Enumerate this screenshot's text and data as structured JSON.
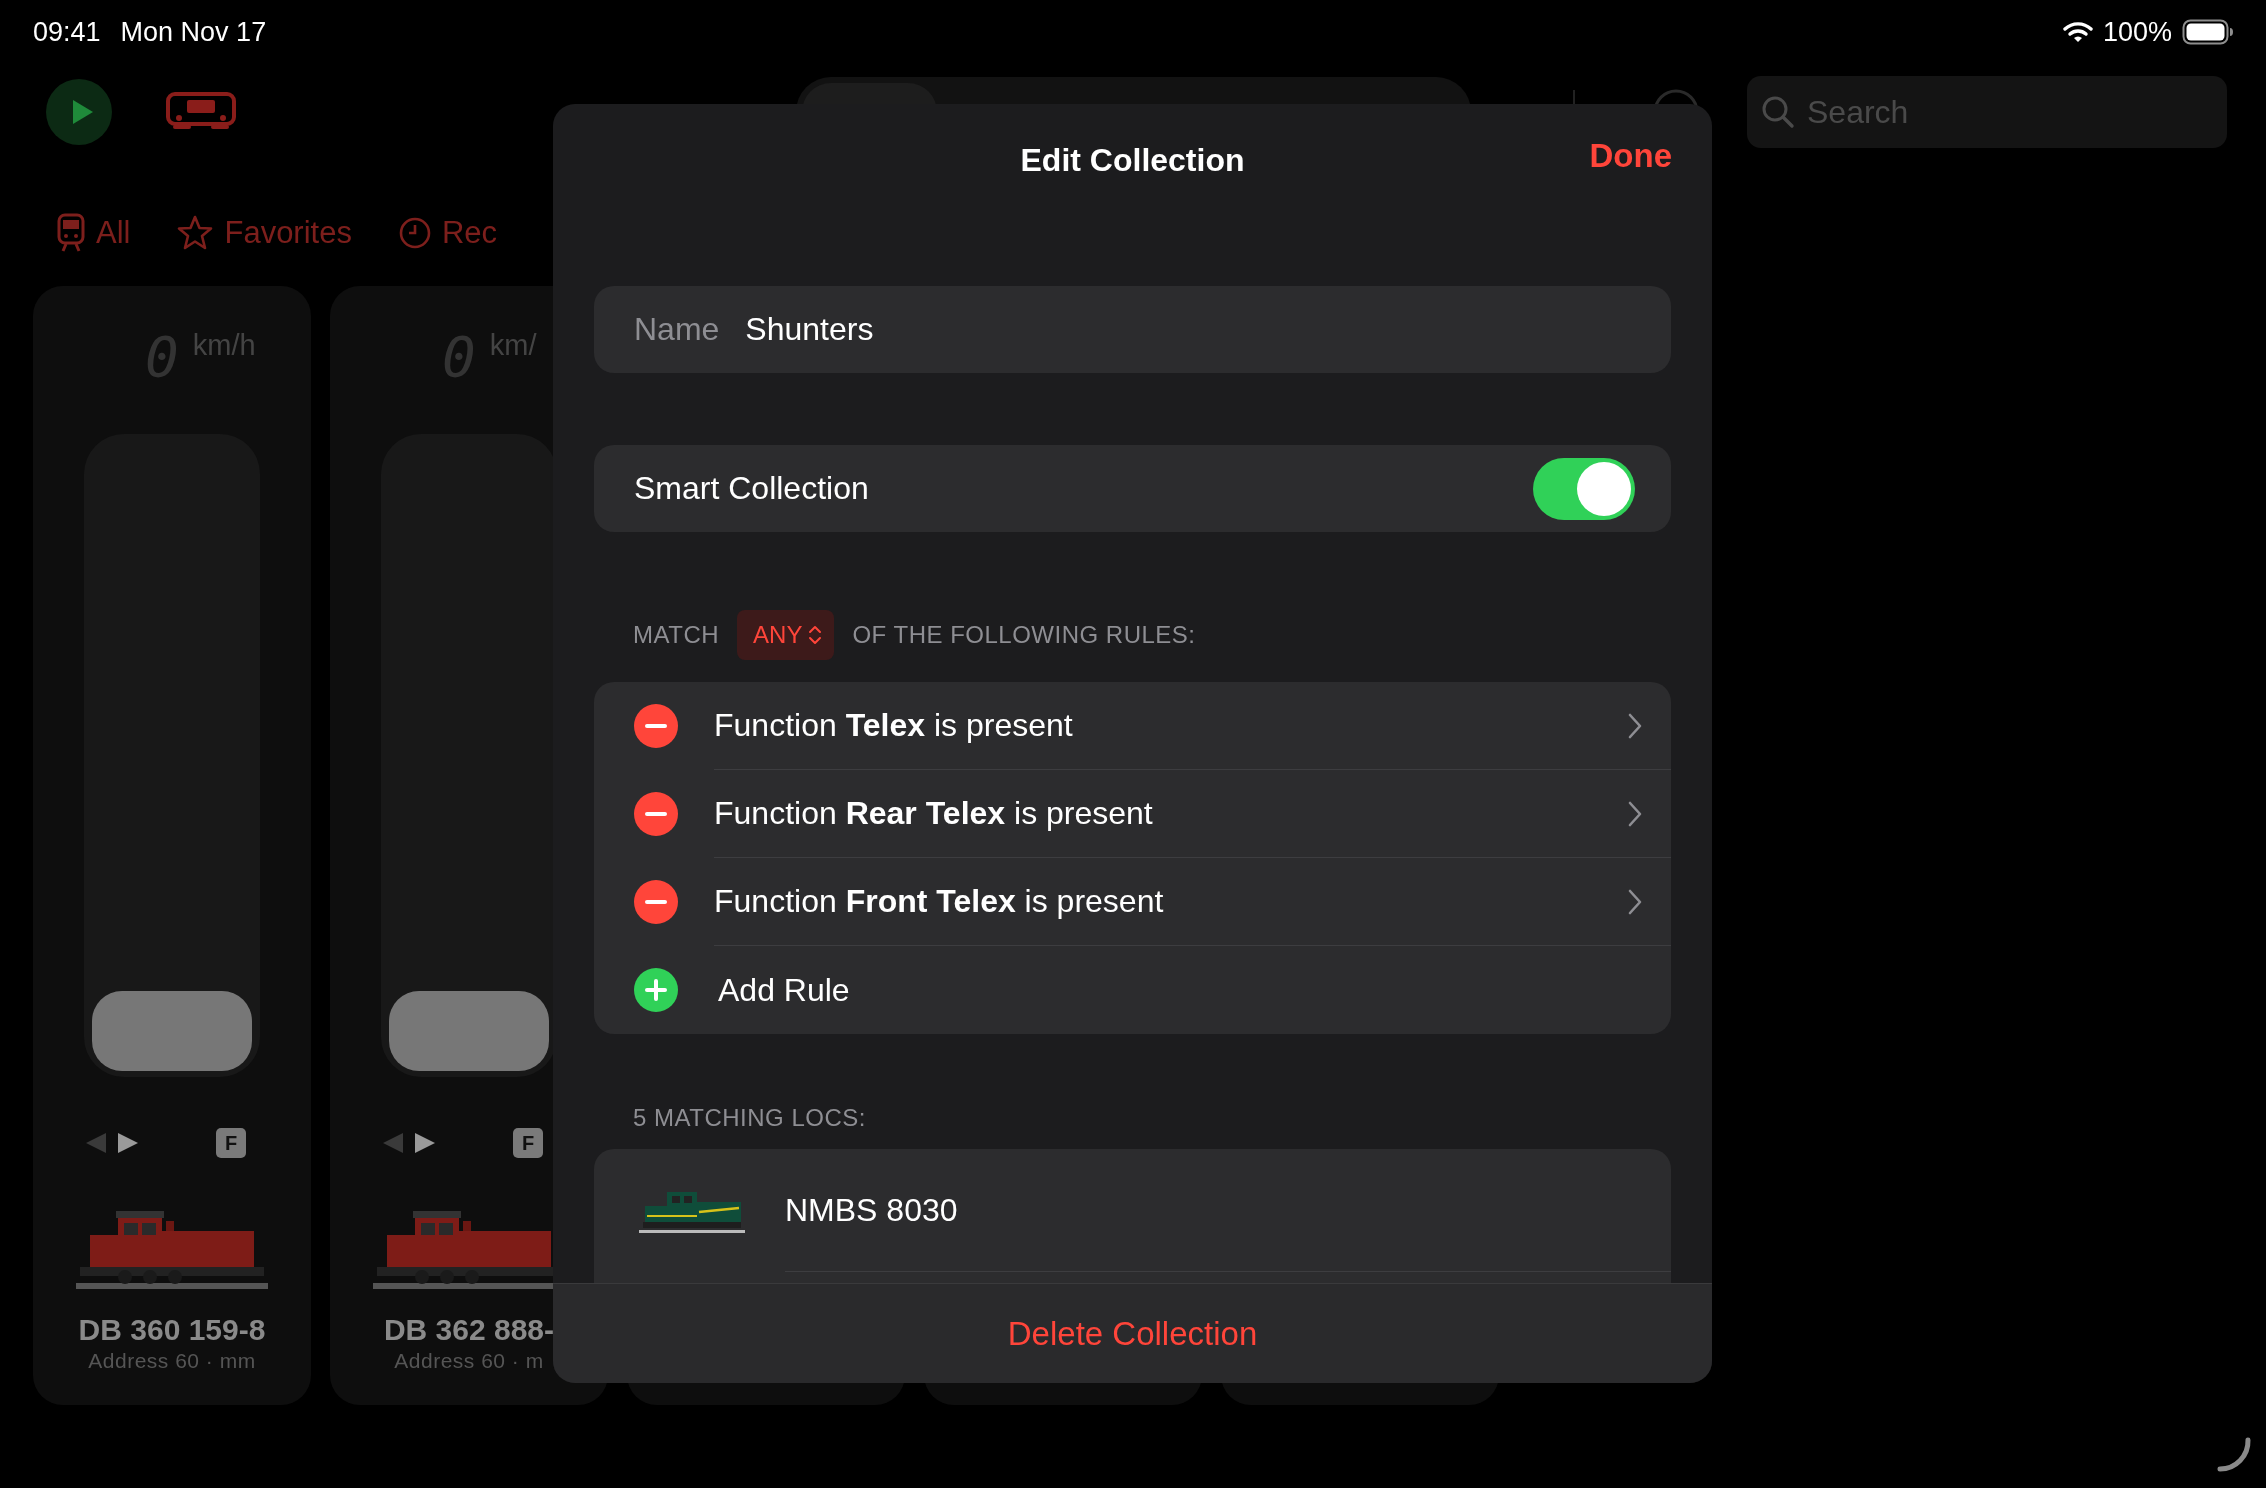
{
  "status_bar": {
    "time": "09:41",
    "date": "Mon Nov 17",
    "battery": "100%"
  },
  "toolbar": {
    "search": {
      "placeholder": "Search"
    }
  },
  "filters": [
    {
      "kind": "all",
      "label": "All"
    },
    {
      "kind": "favorites",
      "label": "Favorites"
    },
    {
      "kind": "recent",
      "label": "Rec"
    }
  ],
  "locos": [
    {
      "kind": "card",
      "speed": "0",
      "unit": "km/h",
      "level": 0,
      "forward": true,
      "function_key": "F",
      "name": "DB 360 159-8",
      "address": "Address 60 · mm"
    },
    {
      "kind": "card",
      "speed": "0",
      "unit": "km/",
      "level": 0,
      "forward": true,
      "function_key": "F",
      "name": "DB 362 888-",
      "address": "Address 60 · m"
    },
    {
      "kind": "covered"
    },
    {
      "kind": "covered"
    },
    {
      "kind": "covered"
    }
  ],
  "modal": {
    "title": "Edit Collection",
    "done": "Done",
    "name_field": {
      "label": "Name",
      "value": "Shunters"
    },
    "smart": {
      "label": "Smart Collection",
      "on": true
    },
    "match": {
      "prefix": "MATCH",
      "mode": "ANY",
      "suffix": "OF THE FOLLOWING RULES:"
    },
    "rules": [
      {
        "text": "Function **Telex** is present"
      },
      {
        "text": "Function **Rear Telex** is present"
      },
      {
        "text": "Function **Front Telex** is present"
      }
    ],
    "add_rule": "Add Rule",
    "matches_header": "5 MATCHING LOCS:",
    "matches": [
      {
        "name": "NMBS 8030"
      }
    ],
    "delete": "Delete Collection"
  }
}
